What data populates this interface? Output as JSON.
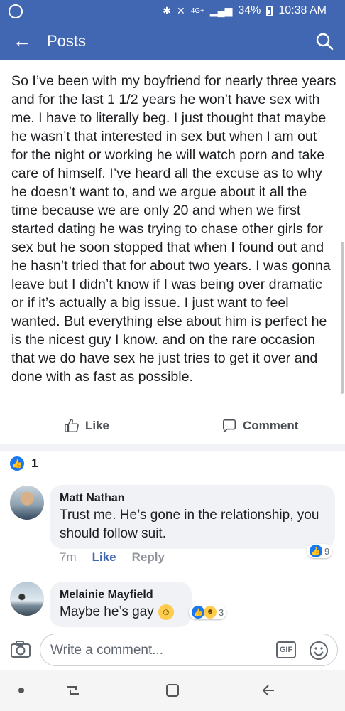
{
  "status_bar": {
    "network": "4G+",
    "battery": "34%",
    "time": "10:38 AM"
  },
  "app_bar": {
    "title": "Posts"
  },
  "post": {
    "text": "So I’ve been with my boyfriend for nearly three years and for the last 1 1/2 years he won’t have sex with me. I have to literally beg. I just thought that maybe he wasn’t that interested in sex but when I am out for the night or working he will watch porn and take care of himself. I’ve heard all the excuse as to why he doesn’t want to, and we argue about it all the time because we are only 20 and when we first started dating he was trying to chase other girls  for sex but he soon stopped that when I found out and he hasn’t tried that for about two years. I was gonna leave but I didn’t know if I was being over dramatic or if it’s actually a big issue. I just want to feel wanted. But everything else about him is perfect he is the nicest guy I know. and on the rare occasion that we do have sex he just tries to get it over and done with as fast as possible."
  },
  "actions": {
    "like_label": "Like",
    "comment_label": "Comment"
  },
  "reactions": {
    "count": "1"
  },
  "comments": [
    {
      "name": "Matt Nathan",
      "text": "Trust me. He’s gone in the relationship, you should follow suit.",
      "time": "7m",
      "like_label": "Like",
      "reply_label": "Reply",
      "reaction_count": "9"
    },
    {
      "name": "Melainie Mayfield",
      "text": "Maybe he’s gay",
      "reaction_count": "3"
    }
  ],
  "composer": {
    "placeholder": "Write a comment...",
    "gif_label": "GIF"
  },
  "colors": {
    "brand": "#4267b2",
    "like_blue": "#1877f2"
  }
}
